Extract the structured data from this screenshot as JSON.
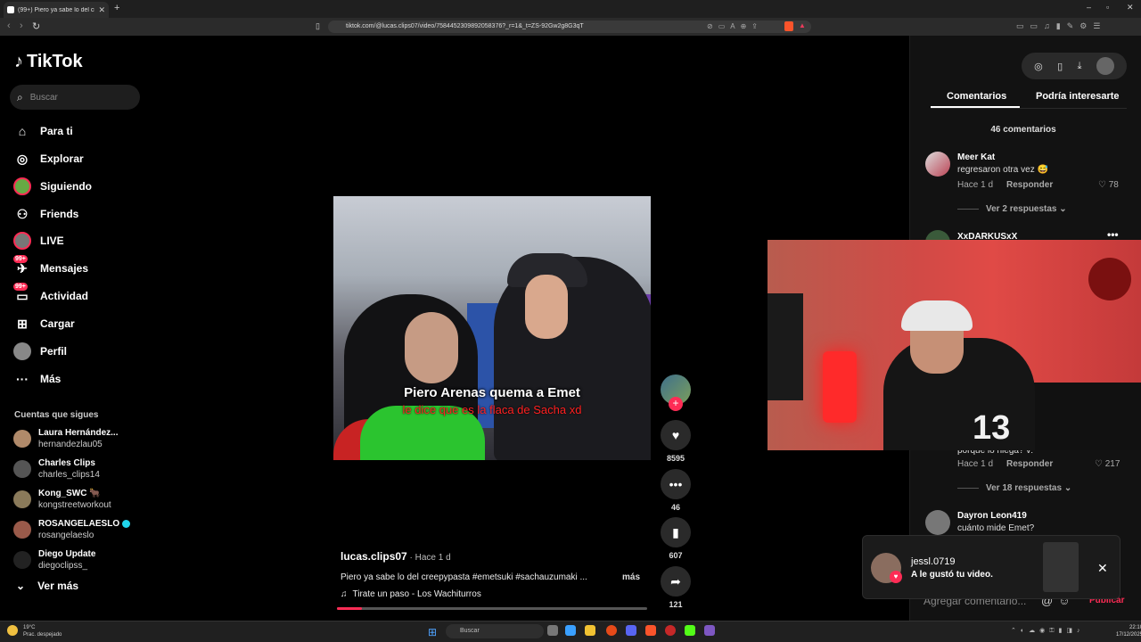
{
  "browser": {
    "tab_title": "(99+) Piero ya sabe lo del creep...",
    "tab_close": "✕",
    "new_tab": "+",
    "window_controls": [
      "–",
      "▫",
      "✕"
    ],
    "url": "tiktok.com/@lucas.clips07/video/7584452309892058376?_r=1&_t=ZS-92Gw2g8G3qT"
  },
  "sidebar": {
    "logo": "TikTok",
    "search_placeholder": "Buscar",
    "nav": [
      {
        "label": "Para ti",
        "icon": "home-icon"
      },
      {
        "label": "Explorar",
        "icon": "compass-icon"
      },
      {
        "label": "Siguiendo",
        "icon": "following-avatar-icon"
      },
      {
        "label": "Friends",
        "icon": "friends-icon"
      },
      {
        "label": "LIVE",
        "icon": "live-icon"
      },
      {
        "label": "Mensajes",
        "icon": "messages-icon",
        "badge": "99+"
      },
      {
        "label": "Actividad",
        "icon": "activity-icon",
        "badge": "99+"
      },
      {
        "label": "Cargar",
        "icon": "upload-icon"
      },
      {
        "label": "Perfil",
        "icon": "profile-icon"
      },
      {
        "label": "Más",
        "icon": "more-icon"
      }
    ],
    "following_title": "Cuentas que sigues",
    "following": [
      {
        "name": "Laura Hernández...",
        "user": "hernandezlau05",
        "color": "#b08a6a"
      },
      {
        "name": "Charles Clips",
        "user": "charles_clips14",
        "color": "#555555"
      },
      {
        "name": "Kong_SWC 🐂",
        "user": "kongstreetworkout",
        "color": "#8a7a5a"
      },
      {
        "name": "ROSANGELAESLO",
        "user": "rosangelaeslo",
        "color": "#9a5a4a",
        "verified": true
      },
      {
        "name": "Diego Update",
        "user": "diegoclipss_",
        "color": "#222222"
      }
    ],
    "see_more": "Ver más"
  },
  "video": {
    "overlay_line1": "Piero Arenas quema a Emet",
    "overlay_line2": "le dice que es la flaca de Sacha xd",
    "author": "lucas.clips07",
    "ago": " · Hace 1 d",
    "description": "Piero ya sabe lo del creepypasta #emetsuki #sachauzumaki ...",
    "more": "más",
    "music": "Tirate un paso - Los Wachiturros",
    "progress": 0.08
  },
  "actions": {
    "likes": "8595",
    "comments": "46",
    "saves": "607",
    "shares": "121"
  },
  "panel": {
    "tab_comments": "Comentarios",
    "tab_interest": "Podría interesarte",
    "count": "46 comentarios",
    "comments": [
      {
        "name": "Meer Kat",
        "text": "regresaron otra vez 😅",
        "ago": "Hace 1 d",
        "reply": "Responder",
        "likes": "78",
        "replies": "Ver 2 respuestas"
      },
      {
        "name": "XxDARKUSxX",
        "text": "porque lo niega? v:",
        "ago": "Hace 1 d",
        "reply": "Responder",
        "likes": "217",
        "replies": "Ver 18 respuestas"
      },
      {
        "name": "Dayron Leon419",
        "text": "cuánto mide Emet?"
      }
    ],
    "comment_placeholder": "Agregar comentario...",
    "publish": "Publicar"
  },
  "notification": {
    "user": "jessl.0719",
    "text": "A le gustó tu video."
  },
  "taskbar": {
    "temp": "19°C",
    "weather": "Prac. despejado",
    "search": "Buscar",
    "time": "22:10",
    "date": "17/12/2025"
  }
}
